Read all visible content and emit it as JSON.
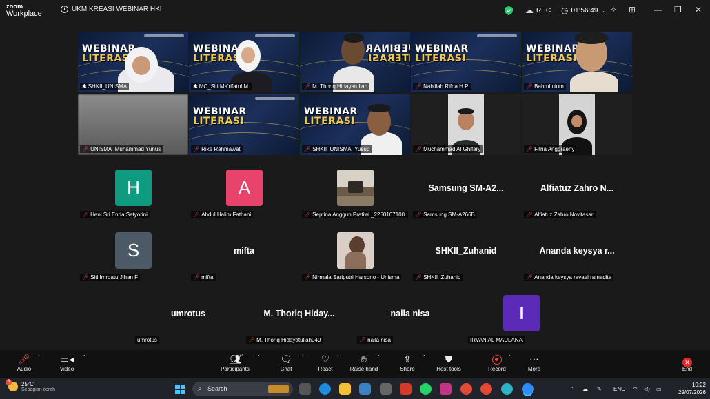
{
  "app": {
    "logo_line1": "zoom",
    "logo_line2": "Workplace",
    "meeting_title": "UKM KREASI WEBINAR HKI",
    "rec_label": "REC",
    "timer": "01:56:49"
  },
  "video_tiles": [
    {
      "name": "SHKII_UNISMA",
      "banner": true,
      "active": true
    },
    {
      "name": "MC_Siti Ma'rifatul M.",
      "banner": true
    },
    {
      "name": "M. Thoriq Hidayatullah",
      "banner": true,
      "mirrored": true
    },
    {
      "name": "Nabiilah Rifda H.P.",
      "banner": true
    },
    {
      "name": "Bahrul ulum",
      "banner": true
    },
    {
      "name": "UNISMA_Muhammad Yunus",
      "banner": false
    },
    {
      "name": "Rike Rahmawati",
      "banner": true
    },
    {
      "name": "SHKII_UNISMA_Yusup",
      "banner": true
    },
    {
      "name": "Muchammad Al Ghifary",
      "banner": false
    },
    {
      "name": "Fitria Anggraeny",
      "banner": false
    }
  ],
  "banner": {
    "line1": "WEBINAR",
    "line2": "LITERASI"
  },
  "participants_grid": [
    {
      "name": "Heni Sri Enda Setyorini",
      "avatar_letter": "H",
      "avatar_color": "#0e9b80"
    },
    {
      "name": "Abdul Halim Fathani",
      "avatar_letter": "A",
      "avatar_color": "#e8436a"
    },
    {
      "name": "Septina Anggun Pratiwi _2250107100...",
      "photo": true
    },
    {
      "name": "Samsung SM-A266B",
      "display": "Samsung  SM-A2..."
    },
    {
      "name": "Alfiatuz Zahro Novitasari",
      "display": "Alfiatuz Zahro N..."
    },
    {
      "name": "Siti Imroatu Jihan F",
      "avatar_letter": "S",
      "avatar_color": "#4b5a66"
    },
    {
      "name": "mifta",
      "display": "mifta"
    },
    {
      "name": "Nirmala Sariputri Harsono - Unisma",
      "photo": true
    },
    {
      "name": "SHKII_Zuhanid",
      "display": "SHKII_Zuhanid"
    },
    {
      "name": "Ananda keysya ravael ramadita",
      "display": "Ananda keysya r..."
    },
    {
      "name": "umrotus",
      "display": "umrotus",
      "muted": false
    },
    {
      "name": "M. Thoriq Hidayatullah049",
      "display": "M. Thoriq Hiday..."
    },
    {
      "name": "naila nisa",
      "display": "naila nisa"
    },
    {
      "name": "IRVAN AL MAULANA",
      "avatar_letter": "I",
      "avatar_color": "#5b2bb8",
      "muted": false
    }
  ],
  "toolbar": {
    "audio": "Audio",
    "video": "Video",
    "participants": "Participants",
    "participants_count": "24",
    "chat": "Chat",
    "react": "React",
    "raise_hand": "Raise hand",
    "share": "Share",
    "host_tools": "Host tools",
    "record": "Record",
    "more": "More",
    "end": "End"
  },
  "taskbar": {
    "temp": "25°C",
    "weather_desc": "Sebagian cerah",
    "weather_badge": "3",
    "search_placeholder": "Search",
    "lang": "ENG",
    "time": "10:22",
    "date": "29/07/2026"
  },
  "colors": {
    "active_speaker": "#3dd68c",
    "muted_red": "#e54848",
    "end_red": "#e02828"
  }
}
